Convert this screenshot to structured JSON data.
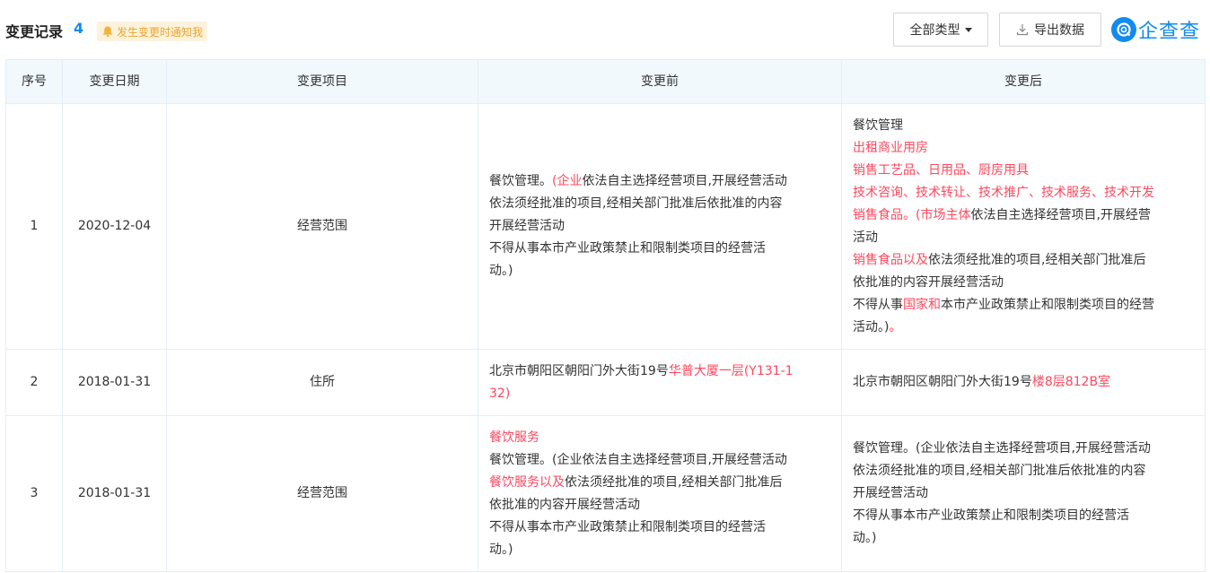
{
  "header": {
    "title": "变更记录",
    "count": "4",
    "notify_label": "发生变更时通知我",
    "type_filter_label": "全部类型",
    "export_label": "导出数据",
    "brand_name": "企查查"
  },
  "colors": {
    "accent": "#128bed",
    "highlight": "#fd485e",
    "notify_bg": "#fdf3dd",
    "notify_text": "#e8a42f",
    "header_bg": "#f2f9fc"
  },
  "table": {
    "columns": [
      "序号",
      "变更日期",
      "变更项目",
      "变更前",
      "变更后"
    ],
    "rows": [
      {
        "index": "1",
        "date": "2020-12-04",
        "item": "经营范围",
        "before": [
          [
            {
              "text": "餐饮管理。",
              "hl": false
            },
            {
              "text": "(企业",
              "hl": true
            },
            {
              "text": "依法自主选择经营项目,开展经营活动",
              "hl": false
            }
          ],
          [
            {
              "text": "依法须经批准的项目,经相关部门批准后依批准的内容",
              "hl": false
            }
          ],
          [
            {
              "text": "开展经营活动",
              "hl": false
            }
          ],
          [
            {
              "text": "不得从事本市产业政策禁止和限制类项目的经营活",
              "hl": false
            }
          ],
          [
            {
              "text": "动。)",
              "hl": false
            }
          ]
        ],
        "after": [
          [
            {
              "text": "餐饮管理",
              "hl": false
            }
          ],
          [
            {
              "text": "出租商业用房",
              "hl": true
            }
          ],
          [
            {
              "text": "销售工艺品、日用品、厨房用具",
              "hl": true
            }
          ],
          [
            {
              "text": "技术咨询、技术转让、技术推广、技术服务、技术开发",
              "hl": true
            }
          ],
          [
            {
              "text": "销售食品。(市场主体",
              "hl": true
            },
            {
              "text": "依法自主选择经营项目,开展经营",
              "hl": false
            }
          ],
          [
            {
              "text": "活动",
              "hl": false
            }
          ],
          [
            {
              "text": "销售食品以及",
              "hl": true
            },
            {
              "text": "依法须经批准的项目,经相关部门批准后",
              "hl": false
            }
          ],
          [
            {
              "text": "依批准的内容开展经营活动",
              "hl": false
            }
          ],
          [
            {
              "text": "不得从事",
              "hl": false
            },
            {
              "text": "国家和",
              "hl": true
            },
            {
              "text": "本市产业政策禁止和限制类项目的经营",
              "hl": false
            }
          ],
          [
            {
              "text": "活动。)",
              "hl": false
            },
            {
              "text": "。",
              "hl": true
            }
          ]
        ]
      },
      {
        "index": "2",
        "date": "2018-01-31",
        "item": "住所",
        "before": [
          [
            {
              "text": "北京市朝阳区朝阳门外大街19号",
              "hl": false
            },
            {
              "text": "华普大厦一层(Y131-1",
              "hl": true
            }
          ],
          [
            {
              "text": "32)",
              "hl": true
            }
          ]
        ],
        "after": [
          [
            {
              "text": "北京市朝阳区朝阳门外大街19号",
              "hl": false
            },
            {
              "text": "楼8层812B室",
              "hl": true
            }
          ]
        ]
      },
      {
        "index": "3",
        "date": "2018-01-31",
        "item": "经营范围",
        "before": [
          [
            {
              "text": "餐饮服务",
              "hl": true
            }
          ],
          [
            {
              "text": "餐饮管理。(企业依法自主选择经营项目,开展经营活动",
              "hl": false
            }
          ],
          [
            {
              "text": "餐饮服务以及",
              "hl": true
            },
            {
              "text": "依法须经批准的项目,经相关部门批准后",
              "hl": false
            }
          ],
          [
            {
              "text": "依批准的内容开展经营活动",
              "hl": false
            }
          ],
          [
            {
              "text": "不得从事本市产业政策禁止和限制类项目的经营活",
              "hl": false
            }
          ],
          [
            {
              "text": "动。)",
              "hl": false
            }
          ]
        ],
        "after": [
          [
            {
              "text": "餐饮管理。(企业依法自主选择经营项目,开展经营活动",
              "hl": false
            }
          ],
          [
            {
              "text": "依法须经批准的项目,经相关部门批准后依批准的内容",
              "hl": false
            }
          ],
          [
            {
              "text": "开展经营活动",
              "hl": false
            }
          ],
          [
            {
              "text": "不得从事本市产业政策禁止和限制类项目的经营活",
              "hl": false
            }
          ],
          [
            {
              "text": "动。)",
              "hl": false
            }
          ]
        ]
      }
    ]
  }
}
